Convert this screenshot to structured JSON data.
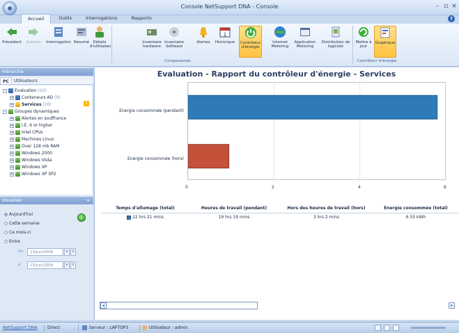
{
  "window": {
    "title": "Console NetSupport DNA - Console",
    "controls": {
      "minimize": "–",
      "restore": "▫",
      "close": "×"
    }
  },
  "ribbon_tabs": [
    {
      "label": "Accueil",
      "active": true
    },
    {
      "label": "Outils",
      "active": false
    },
    {
      "label": "Interrogations",
      "active": false
    },
    {
      "label": "Rapports",
      "active": false
    }
  ],
  "ribbon_buttons": [
    {
      "id": "precedent",
      "label": "Précédent",
      "icon": "arrow-left-icon"
    },
    {
      "id": "suivant",
      "label": "Suivant",
      "icon": "arrow-right-icon"
    },
    {
      "id": "interrogation",
      "label": "Interrogation",
      "icon": "query-icon"
    },
    {
      "id": "resume",
      "label": "Résumé",
      "icon": "summary-icon"
    },
    {
      "id": "details",
      "label": "Détails d'utilisateur",
      "icon": "user-details-icon"
    },
    {
      "id": "inv-hw",
      "label": "Inventaire hardware",
      "icon": "hardware-icon"
    },
    {
      "id": "inv-sw",
      "label": "Inventaire Software",
      "icon": "software-icon"
    },
    {
      "id": "alertes",
      "label": "Alertes",
      "icon": "alert-icon"
    },
    {
      "id": "historique",
      "label": "Historique",
      "icon": "calendar-icon"
    },
    {
      "id": "controleur",
      "label": "Contrôleur d'énergie",
      "icon": "power-icon",
      "active": true
    },
    {
      "id": "internet",
      "label": "Internet Metering",
      "icon": "globe-icon"
    },
    {
      "id": "application",
      "label": "Application Metering",
      "icon": "application-icon"
    },
    {
      "id": "distribution",
      "label": "Distribution de logiciels",
      "icon": "distribution-icon"
    },
    {
      "id": "mettre",
      "label": "Mettre à jour",
      "icon": "refresh-icon"
    },
    {
      "id": "graphique",
      "label": "Graphique",
      "icon": "chart-icon",
      "active": true
    }
  ],
  "ribbon_groups": {
    "composantes": "Composantes",
    "controleur": "Contrôleur d'énergie"
  },
  "left": {
    "hierarchy_title": "Hiérarchie",
    "pc_tabs": [
      {
        "label": "PC",
        "active": true
      },
      {
        "label": "Utilisateurs",
        "active": false
      }
    ],
    "tree": [
      {
        "label": "Evaluation",
        "count": "(10)"
      },
      {
        "label": "Conteneurs AD",
        "count": "(0)"
      },
      {
        "label": "Services",
        "count": "(10)",
        "selected": true
      },
      {
        "label": "Groupes dynamiques",
        "count": ""
      },
      {
        "label": "Alertes en souffrance",
        "count": ""
      },
      {
        "label": "I.E. 6 or higher",
        "count": ""
      },
      {
        "label": "Intel CPUs",
        "count": ""
      },
      {
        "label": "Machines Linux",
        "count": ""
      },
      {
        "label": "Over 128 mb RAM",
        "count": ""
      },
      {
        "label": "Windows 2000",
        "count": ""
      },
      {
        "label": "Windows Vista",
        "count": ""
      },
      {
        "label": "Windows XP",
        "count": ""
      },
      {
        "label": "Windows XP SP2",
        "count": ""
      }
    ],
    "view_title": "Visualiser",
    "view_options": [
      {
        "label": "Aujourd'hui",
        "selected": true
      },
      {
        "label": "Cette semaine",
        "selected": false
      },
      {
        "label": "Ce mois-ci",
        "selected": false
      },
      {
        "label": "Entre",
        "selected": false
      }
    ],
    "date_from_label": "De",
    "date_from": "13/Jun/2008",
    "date_to_label": "à",
    "date_to": "15/Jun/2008"
  },
  "report": {
    "title": "Evaluation - Rapport du contrôleur d'énergie - Services"
  },
  "chart_data": {
    "type": "bar",
    "orientation": "horizontal",
    "categories": [
      "Energie consommée (pendant)",
      "Energie consommée (hors)"
    ],
    "values": [
      5.8,
      0.95
    ],
    "colors": [
      "#2e7bb8",
      "#c4523b"
    ],
    "xlim": [
      0,
      6
    ],
    "xticks": [
      "0",
      "2",
      "4",
      "6"
    ],
    "grid": true
  },
  "table": {
    "headers": [
      "Temps d'allumage (total)",
      "Heures de travail (pendant)",
      "Hors des heures de travail (hors)",
      "Energie consommée (total)"
    ],
    "row": [
      "22 hrs 21 mins",
      "19 hrs 19 mins",
      "3 hrs 2 mins",
      "6.55 kWh"
    ]
  },
  "statusbar": {
    "link": "NetSupport DNA",
    "mode": "Direct",
    "server": "Serveur : LAPTOP3",
    "user": "Utilisateur : admin"
  }
}
